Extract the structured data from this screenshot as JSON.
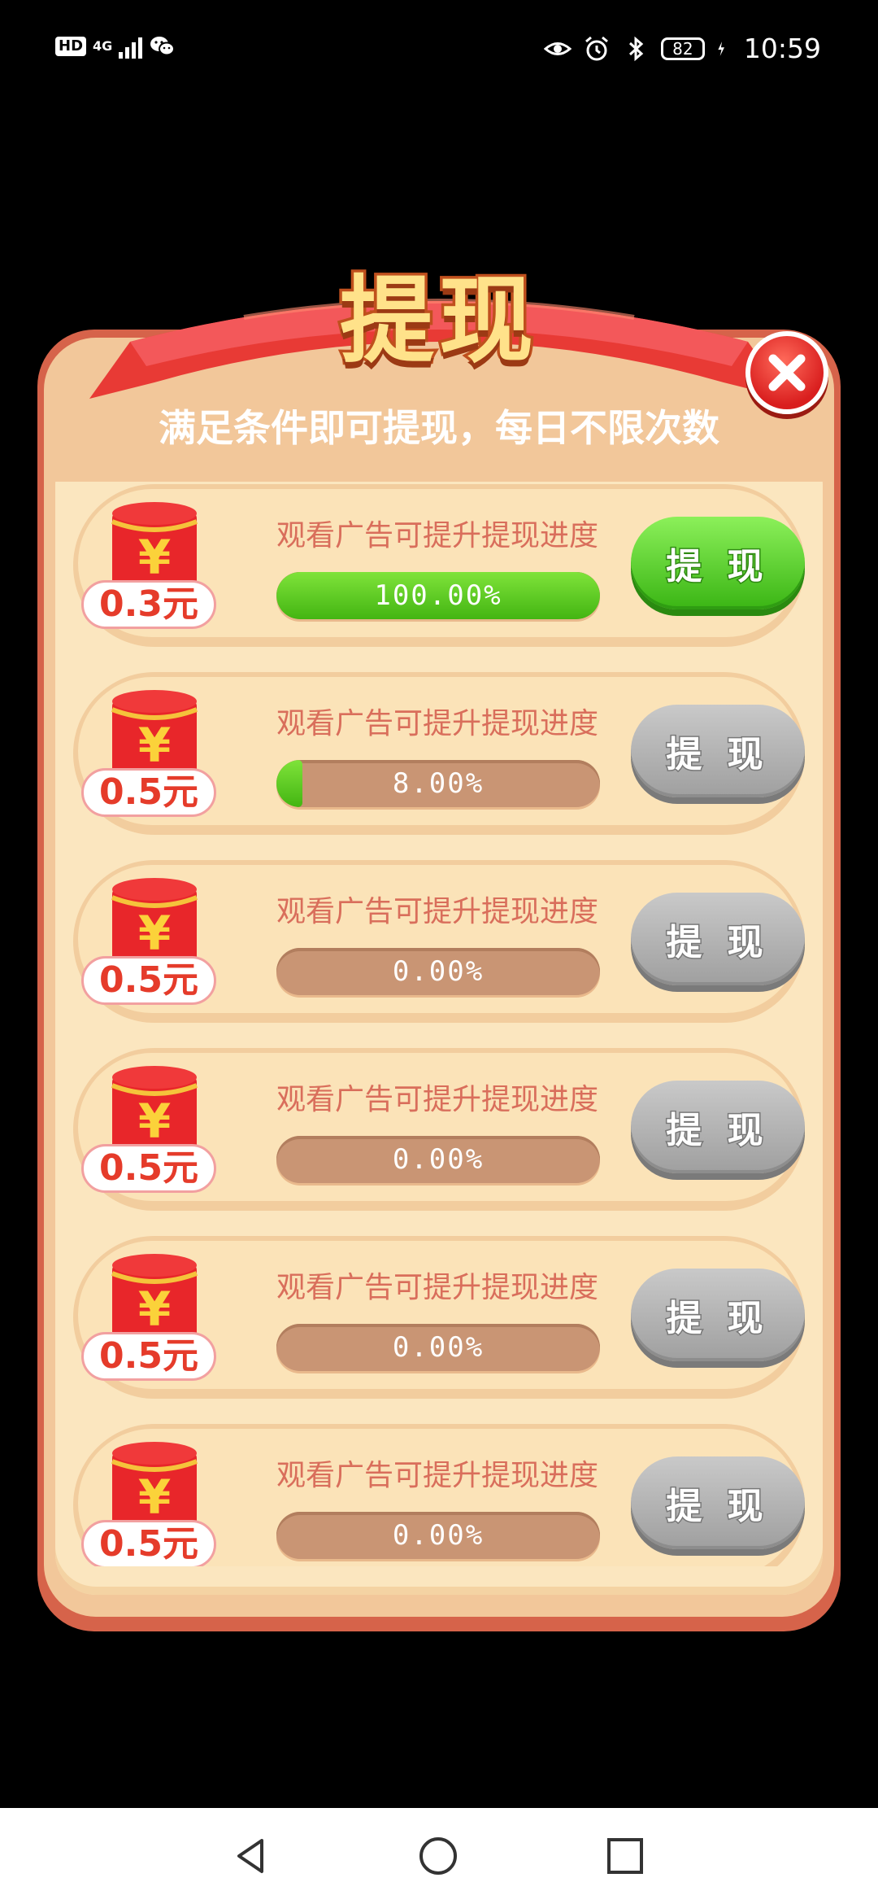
{
  "status_bar": {
    "hd": "HD",
    "network": "4G",
    "battery": "82",
    "time": "10:59"
  },
  "dialog": {
    "title": "提现",
    "subtitle": "满足条件即可提现，每日不限次数",
    "rows": [
      {
        "amount": "0.3元",
        "desc": "观看广告可提升提现进度",
        "progress_text": "100.00%",
        "progress": 1.0,
        "button": "提 现",
        "enabled": true
      },
      {
        "amount": "0.5元",
        "desc": "观看广告可提升提现进度",
        "progress_text": "8.00%",
        "progress": 0.08,
        "button": "提 现",
        "enabled": false
      },
      {
        "amount": "0.5元",
        "desc": "观看广告可提升提现进度",
        "progress_text": "0.00%",
        "progress": 0.0,
        "button": "提 现",
        "enabled": false
      },
      {
        "amount": "0.5元",
        "desc": "观看广告可提升提现进度",
        "progress_text": "0.00%",
        "progress": 0.0,
        "button": "提 现",
        "enabled": false
      },
      {
        "amount": "0.5元",
        "desc": "观看广告可提升提现进度",
        "progress_text": "0.00%",
        "progress": 0.0,
        "button": "提 现",
        "enabled": false
      },
      {
        "amount": "0.5元",
        "desc": "观看广告可提升提现进度",
        "progress_text": "0.00%",
        "progress": 0.0,
        "button": "提 现",
        "enabled": false
      }
    ]
  },
  "colors": {
    "accent_red": "#e53b2a",
    "enabled_button": "#3ab514",
    "disabled_button": "#9f9f9f",
    "progress_fill": "#43b512"
  },
  "icons": {
    "close": "close-icon",
    "packet": "red-packet-icon",
    "nav_back": "back-icon",
    "nav_home": "home-icon",
    "nav_recents": "recents-icon"
  }
}
